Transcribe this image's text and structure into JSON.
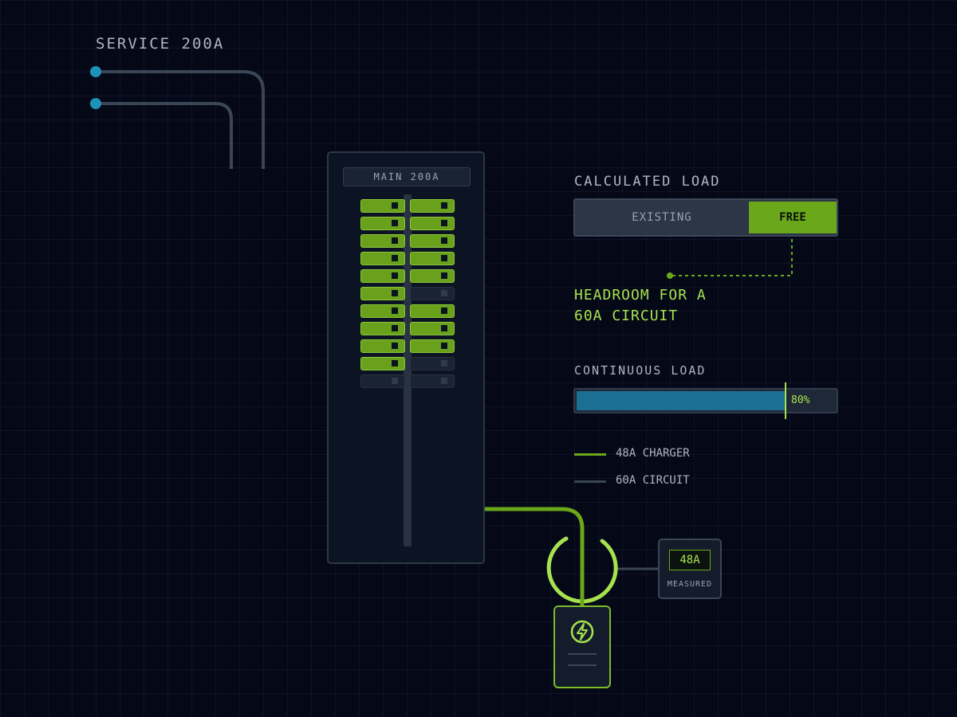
{
  "service": {
    "label": "SERVICE 200A"
  },
  "panel": {
    "main_label": "MAIN 200A",
    "breakers": [
      [
        "on",
        "on"
      ],
      [
        "on",
        "on"
      ],
      [
        "on",
        "on"
      ],
      [
        "on",
        "on"
      ],
      [
        "on",
        "on"
      ],
      [
        "on",
        "off"
      ],
      [
        "on",
        "on"
      ],
      [
        "on",
        "on"
      ],
      [
        "on",
        "on"
      ],
      [
        "on",
        "off"
      ],
      [
        "off",
        "off"
      ]
    ]
  },
  "calculated_load": {
    "title": "CALCULATED LOAD",
    "existing_label": "EXISTING",
    "free_label": "FREE",
    "headroom_line1": "HEADROOM FOR A",
    "headroom_line2": "60A CIRCUIT"
  },
  "continuous_load": {
    "title": "CONTINUOUS LOAD",
    "fill_fraction": 0.8,
    "marker_label": "80%"
  },
  "legend": {
    "items": [
      {
        "label": "48A CHARGER",
        "color": "#6aa71a"
      },
      {
        "label": "60A CIRCUIT",
        "color": "#3a4556"
      }
    ]
  },
  "meter": {
    "value": "48A",
    "label": "MEASURED"
  },
  "charger": {
    "icon": "lightning-bolt-icon"
  },
  "colors": {
    "background": "#040817",
    "accent_green": "#a6e24e",
    "breaker_green": "#6aa11c",
    "service_blue": "#1e93b8",
    "load_blue": "#1a6f93"
  }
}
